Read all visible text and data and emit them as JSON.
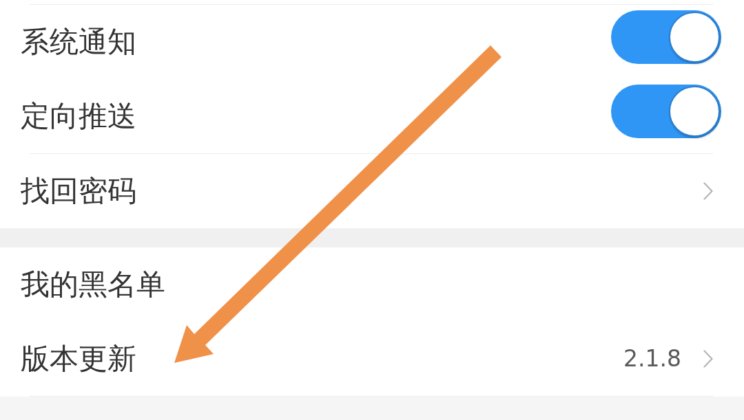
{
  "groups": [
    {
      "items": [
        {
          "kind": "toggle",
          "label": "系统通知",
          "on": true,
          "divider_above": true
        },
        {
          "kind": "toggle",
          "label": "定向推送",
          "on": true,
          "divider_above": false
        },
        {
          "kind": "link",
          "label": "找回密码",
          "divider_above": true
        }
      ],
      "divider_below": false
    },
    {
      "items": [
        {
          "kind": "plain",
          "label": "我的黑名单",
          "divider_above": false
        },
        {
          "kind": "link",
          "label": "版本更新",
          "value": "2.1.8",
          "divider_above": false
        }
      ],
      "divider_below": true
    }
  ]
}
